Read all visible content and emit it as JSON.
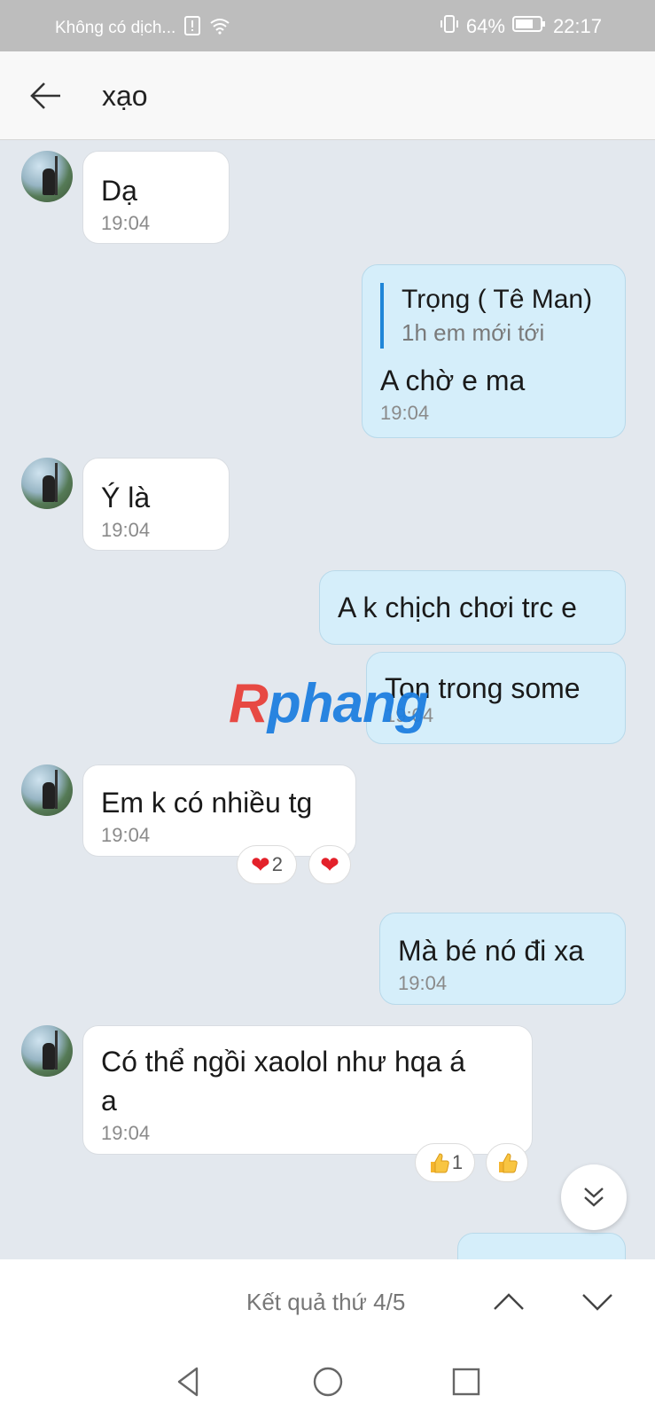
{
  "status_bar": {
    "carrier": "Không có dịch...",
    "battery": "64%",
    "time": "22:17"
  },
  "header": {
    "title": "xạo"
  },
  "messages": [
    {
      "side": "in",
      "text": "Dạ",
      "time": "19:04"
    },
    {
      "side": "out",
      "reply_name": "Trọng ( Tê Man)",
      "reply_text": "1h em mới tới",
      "text": "A chờ e ma",
      "time": "19:04"
    },
    {
      "side": "in",
      "text": "Ý là",
      "time": "19:04"
    },
    {
      "side": "out",
      "text": "A k chịch chơi trc e"
    },
    {
      "side": "out",
      "text": "Ton trong some",
      "time": "19:04"
    },
    {
      "side": "in",
      "text": "Em k có nhiều tg",
      "time": "19:04",
      "reaction_count": "2"
    },
    {
      "side": "out",
      "text": "Mà bé nó đi xa",
      "time": "19:04"
    },
    {
      "side": "in",
      "text_line1": "Có thể ngồi xaolol như hqa á",
      "text_line2": "a",
      "time": "19:04",
      "reaction_count": "1"
    }
  ],
  "watermark": {
    "part1": "R",
    "part2": "phang"
  },
  "search": {
    "result_text": "Kết quả thứ 4/5"
  },
  "colors": {
    "chat_background": "#e3e8ee",
    "outgoing_bubble": "#d5eefa",
    "incoming_bubble": "#ffffff",
    "reply_accent": "#1f86d8"
  }
}
